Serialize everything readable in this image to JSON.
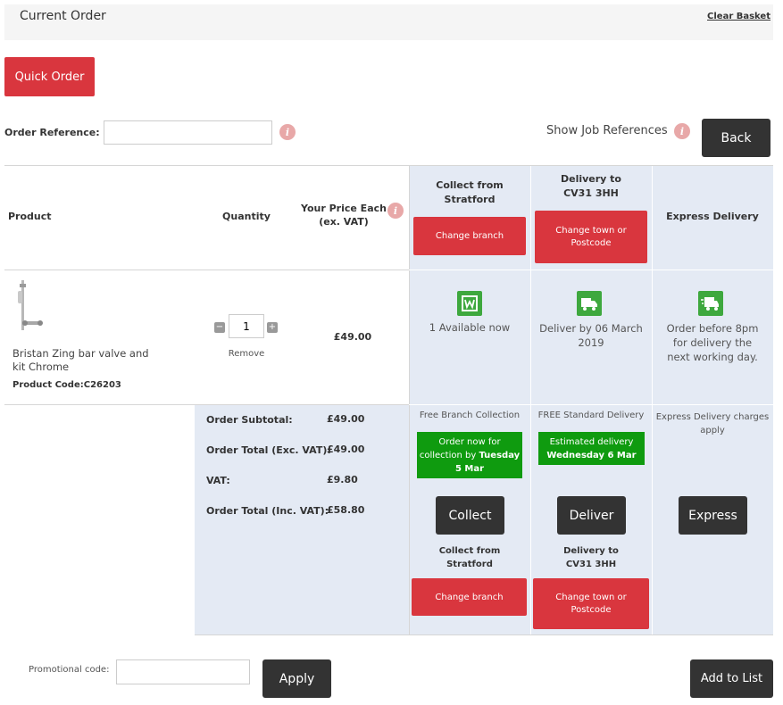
{
  "header": {
    "title": "Current Order",
    "clear_basket": "Clear Basket"
  },
  "quick_order": "Quick Order",
  "order_reference": {
    "label": "Order Reference:",
    "value": "",
    "placeholder": ""
  },
  "show_job_references": "Show Job References",
  "back": "Back",
  "table": {
    "columns": {
      "product": "Product",
      "quantity": "Quantity",
      "price_line1": "Your Price Each",
      "price_line2": "(ex. VAT)",
      "collect_line1": "Collect from",
      "collect_line2": "Stratford",
      "delivery_line1": "Delivery to",
      "delivery_line2": "CV31 3HH",
      "express": "Express Delivery"
    },
    "change_branch": "Change branch",
    "change_town_line1": "Change town or",
    "change_town_line2": "Postcode"
  },
  "product": {
    "name_line1": "Bristan Zing bar valve and",
    "name_line2": "kit Chrome",
    "code": "Product Code:C26203",
    "quantity": "1",
    "remove": "Remove",
    "price": "£49.00",
    "collect_availability": "1 Available now",
    "delivery_line1": "Deliver by 06 March",
    "delivery_line2": "2019",
    "express_line1": "Order before 8pm",
    "express_line2": "for delivery the",
    "express_line3": "next working day."
  },
  "summary": {
    "subtotal_label": "Order Subtotal:",
    "subtotal_value": "£49.00",
    "total_ex_label": "Order Total (Exc. VAT):",
    "total_ex_value": "£49.00",
    "vat_label": "VAT:",
    "vat_value": "£9.80",
    "total_inc_label": "Order Total (Inc. VAT):",
    "total_inc_value": "£58.80"
  },
  "collect": {
    "title": "Free Branch Collection",
    "green_line1": "Order now for",
    "green_line2a": "collection by ",
    "green_line2b": "Tuesday",
    "green_line3": "5 Mar",
    "button": "Collect",
    "sub_line1": "Collect from",
    "sub_line2": "Stratford"
  },
  "deliver": {
    "title": "FREE Standard Delivery",
    "green_line1": "Estimated delivery",
    "green_line2": "Wednesday 6 Mar",
    "button": "Deliver",
    "sub_line1": "Delivery to",
    "sub_line2": "CV31 3HH"
  },
  "express": {
    "title_line1": "Express Delivery charges",
    "title_line2": "apply",
    "button": "Express"
  },
  "promo": {
    "label": "Promotional code:",
    "value": "",
    "placeholder": ""
  },
  "apply": "Apply",
  "add_to_list": "Add to List",
  "colors": {
    "red": "#d9363e",
    "dark": "#333333",
    "green": "#0f9b0f",
    "panel": "#e4eaf4"
  }
}
